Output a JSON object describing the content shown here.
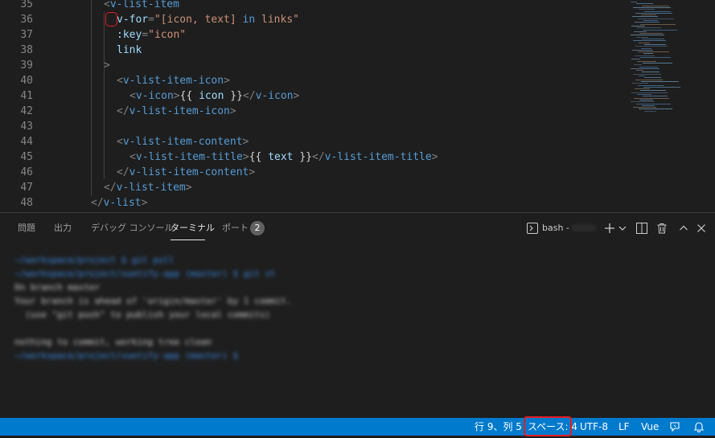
{
  "editor": {
    "lines": [
      {
        "n": "35",
        "tokens": [
          [
            "pun",
            "<"
          ],
          [
            "tag",
            "v-list-item"
          ]
        ]
      },
      {
        "n": "36",
        "tokens": [
          [
            "attr",
            "v-for"
          ],
          [
            "pun",
            "="
          ],
          [
            "str",
            "\"[icon, text] "
          ],
          [
            "kw",
            "in"
          ],
          [
            "str",
            " links\""
          ]
        ]
      },
      {
        "n": "37",
        "tokens": [
          [
            "attr",
            ":key"
          ],
          [
            "pun",
            "="
          ],
          [
            "str",
            "\"icon\""
          ]
        ]
      },
      {
        "n": "38",
        "tokens": [
          [
            "attr",
            "link"
          ]
        ]
      },
      {
        "n": "39",
        "tokens": [
          [
            "pun",
            ">"
          ]
        ]
      },
      {
        "n": "40",
        "tokens": [
          [
            "pun",
            "<"
          ],
          [
            "tag",
            "v-list-item-icon"
          ],
          [
            "pun",
            ">"
          ]
        ]
      },
      {
        "n": "41",
        "tokens": [
          [
            "pun",
            "<"
          ],
          [
            "tag",
            "v-icon"
          ],
          [
            "pun",
            ">"
          ],
          [
            "txt",
            "{{ "
          ],
          [
            "ident",
            "icon"
          ],
          [
            "txt",
            " }}"
          ],
          [
            "pun",
            "</"
          ],
          [
            "tag",
            "v-icon"
          ],
          [
            "pun",
            ">"
          ]
        ]
      },
      {
        "n": "42",
        "tokens": [
          [
            "pun",
            "</"
          ],
          [
            "tag",
            "v-list-item-icon"
          ],
          [
            "pun",
            ">"
          ]
        ]
      },
      {
        "n": "43",
        "tokens": []
      },
      {
        "n": "44",
        "tokens": [
          [
            "pun",
            "<"
          ],
          [
            "tag",
            "v-list-item-content"
          ],
          [
            "pun",
            ">"
          ]
        ]
      },
      {
        "n": "45",
        "tokens": [
          [
            "pun",
            "<"
          ],
          [
            "tag",
            "v-list-item-title"
          ],
          [
            "pun",
            ">"
          ],
          [
            "txt",
            "{{ "
          ],
          [
            "ident",
            "text"
          ],
          [
            "txt",
            " }}"
          ],
          [
            "pun",
            "</"
          ],
          [
            "tag",
            "v-list-item-title"
          ],
          [
            "pun",
            ">"
          ]
        ]
      },
      {
        "n": "46",
        "tokens": [
          [
            "pun",
            "</"
          ],
          [
            "tag",
            "v-list-item-content"
          ],
          [
            "pun",
            ">"
          ]
        ]
      },
      {
        "n": "47",
        "tokens": [
          [
            "pun",
            "</"
          ],
          [
            "tag",
            "v-list-item"
          ],
          [
            "pun",
            ">"
          ]
        ]
      },
      {
        "n": "48",
        "tokens": [
          [
            "pun",
            "</"
          ],
          [
            "tag",
            "v-list"
          ],
          [
            "pun",
            ">"
          ]
        ]
      }
    ]
  },
  "panel": {
    "tabs": [
      "問題",
      "出力",
      "デバッグ コンソール",
      "ターミナル",
      "ポート"
    ],
    "active_tab": "ターミナル",
    "ports_badge": "2",
    "terminal_label": "bash -",
    "terminal_lines": [
      "~/workspace/project $ git pull",
      "~/workspace/project/vuetify-app (master) $ git st",
      "On branch master",
      "Your branch is ahead of 'origin/master' by 1 commit.",
      "  (use \"git push\" to publish your local commits)",
      "",
      "nothing to commit, working tree clean",
      "~/workspace/project/vuetify-app (master) $ "
    ]
  },
  "statusbar": {
    "position": "行 9、列 5",
    "spaces": "スペース: 4",
    "encoding": "UTF-8",
    "eol": "LF",
    "language": "Vue"
  },
  "colors": {
    "statusbar": "#007acc",
    "highlight": "#e51c23",
    "tag": "#569cd6",
    "attribute": "#9cdcfe",
    "string": "#ce9178"
  }
}
